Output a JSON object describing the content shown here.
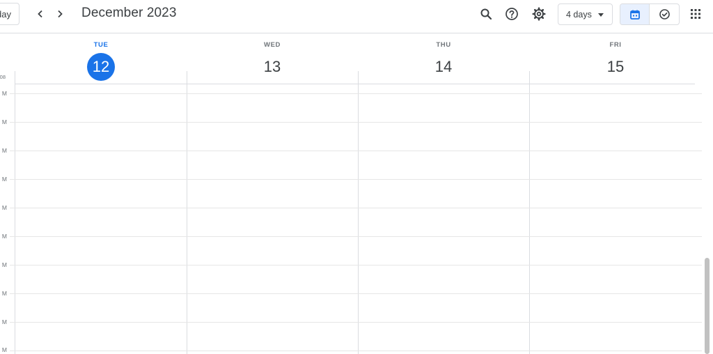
{
  "header": {
    "today_label": "day",
    "month_title": "December 2023",
    "view_label": "4 days"
  },
  "days": [
    {
      "name": "TUE",
      "number": "12",
      "today": true
    },
    {
      "name": "WED",
      "number": "13",
      "today": false
    },
    {
      "name": "THU",
      "number": "14",
      "today": false
    },
    {
      "name": "FRI",
      "number": "15",
      "today": false
    }
  ],
  "timezone_label": "08",
  "time_labels": [
    "M",
    "M",
    "M",
    "M",
    "M",
    "M",
    "M",
    "M",
    "M",
    "M"
  ],
  "colors": {
    "accent": "#1a73e8",
    "accent_light": "#e8f0fe",
    "grid_line": "#dadce0",
    "text": "#3c4043",
    "muted": "#70757a"
  },
  "icons": {
    "prev": "chevron-left-icon",
    "next": "chevron-right-icon",
    "search": "search-icon",
    "help": "help-icon",
    "settings": "gear-icon",
    "dropdown": "caret-down-icon",
    "calendar": "calendar-icon",
    "tasks": "check-circle-icon",
    "apps": "apps-grid-icon"
  }
}
